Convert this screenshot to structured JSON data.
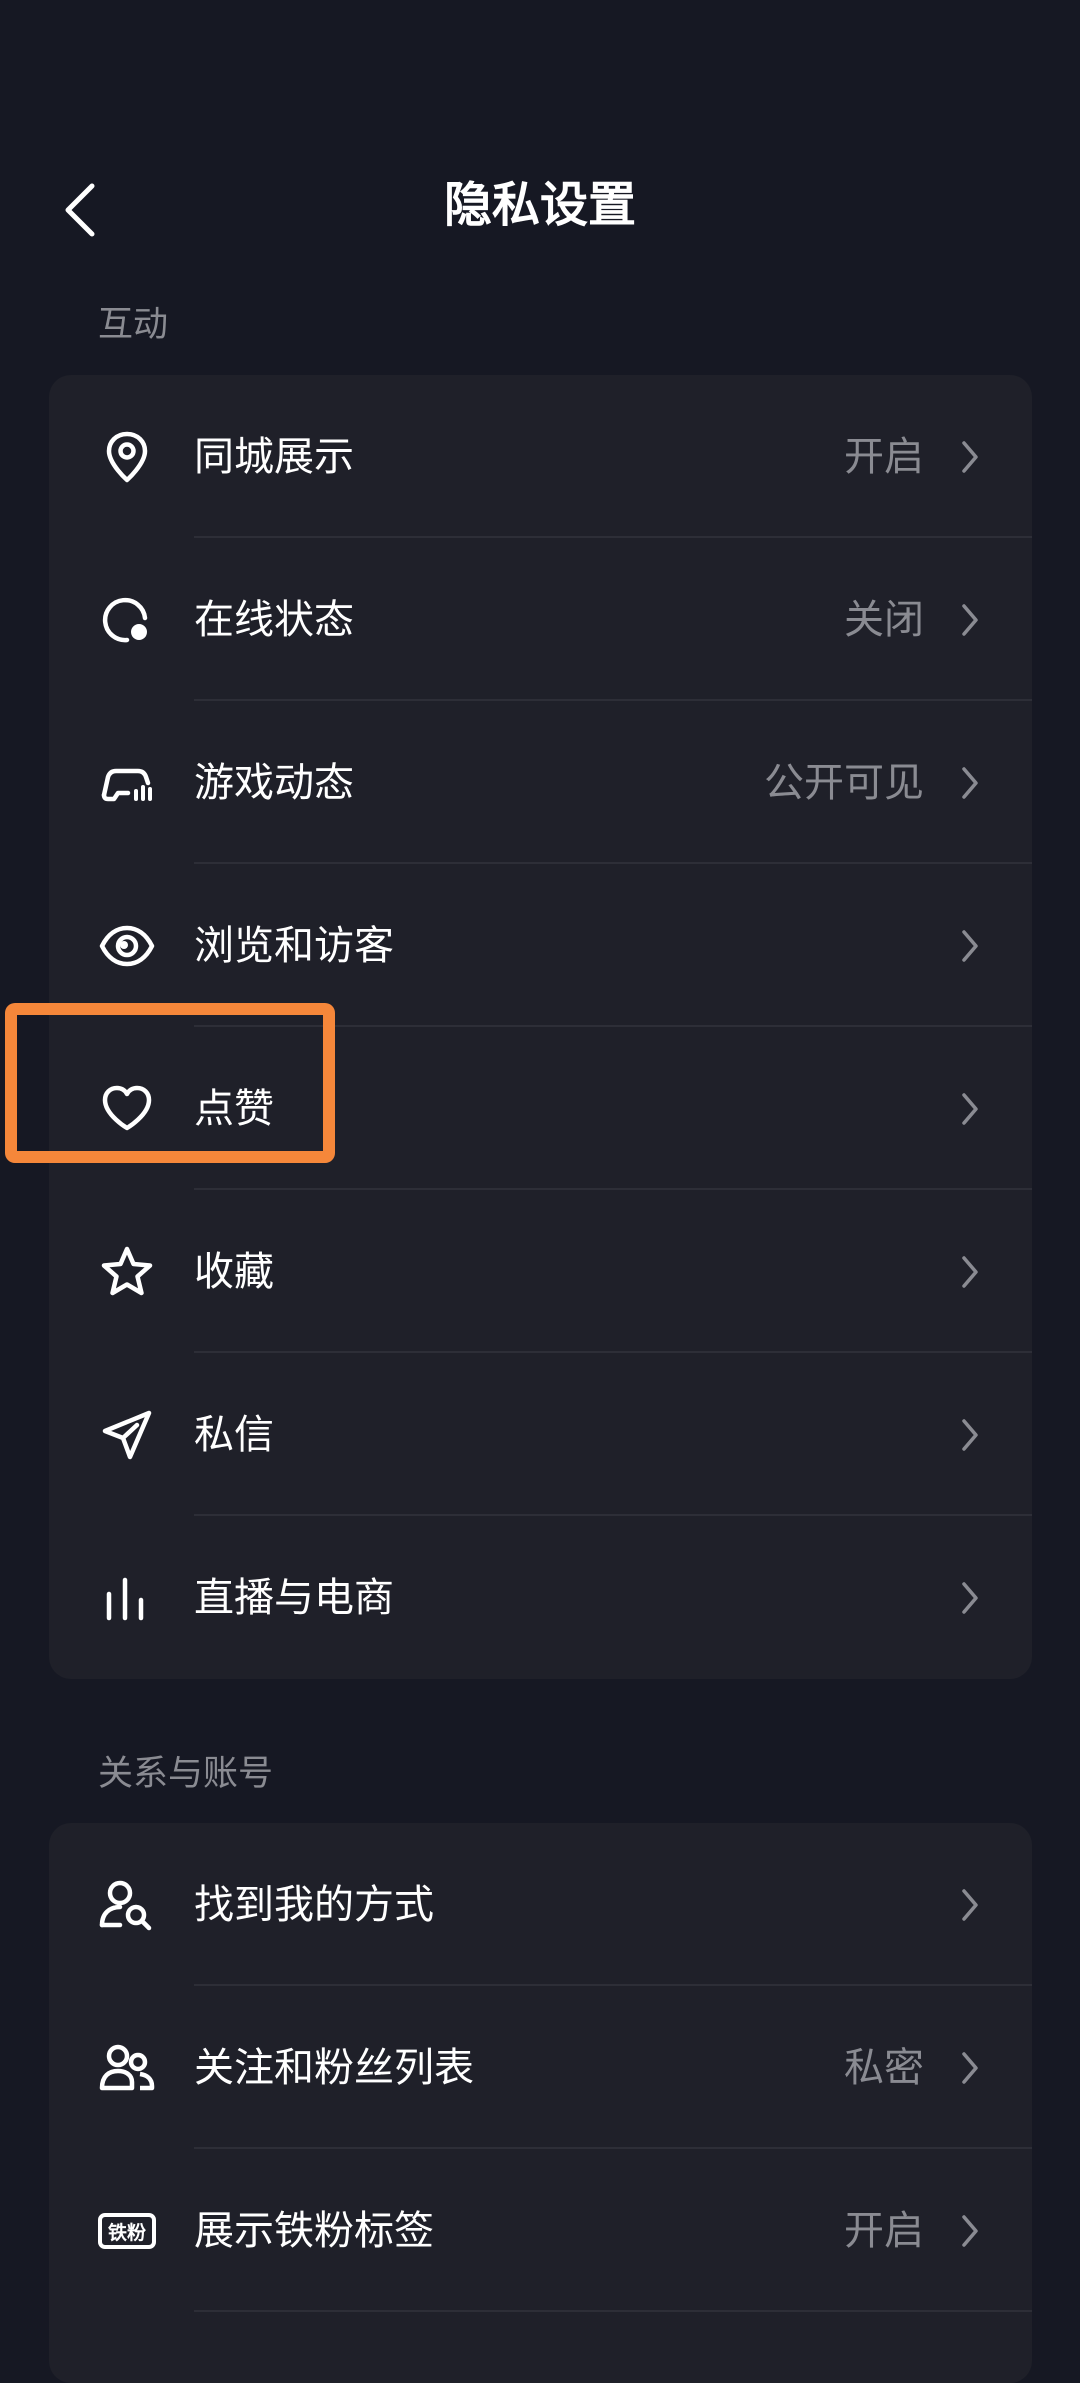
{
  "header": {
    "title": "隐私设置",
    "back_icon": "chevron-left-icon"
  },
  "sections": [
    {
      "title": "互动",
      "items": [
        {
          "label": "同城展示",
          "value": "开启",
          "icon": "location-pin-icon"
        },
        {
          "label": "在线状态",
          "value": "关闭",
          "icon": "online-status-icon"
        },
        {
          "label": "游戏动态",
          "value": "公开可见",
          "icon": "game-controller-icon"
        },
        {
          "label": "浏览和访客",
          "value": "",
          "icon": "eye-icon"
        },
        {
          "label": "点赞",
          "value": "",
          "icon": "heart-icon"
        },
        {
          "label": "收藏",
          "value": "",
          "icon": "star-icon"
        },
        {
          "label": "私信",
          "value": "",
          "icon": "paper-plane-icon"
        },
        {
          "label": "直播与电商",
          "value": "",
          "icon": "live-bars-icon"
        }
      ]
    },
    {
      "title": "关系与账号",
      "items": [
        {
          "label": "找到我的方式",
          "value": "",
          "icon": "user-search-icon"
        },
        {
          "label": "关注和粉丝列表",
          "value": "私密",
          "icon": "users-icon"
        },
        {
          "label": "展示铁粉标签",
          "value": "开启",
          "icon": "fan-badge-icon"
        }
      ]
    }
  ],
  "fan_badge_text": "铁粉",
  "colors": {
    "background": "#161823",
    "card": "#1f2029",
    "secondary_text": "#8a8b92",
    "highlight": "#f5873a"
  }
}
